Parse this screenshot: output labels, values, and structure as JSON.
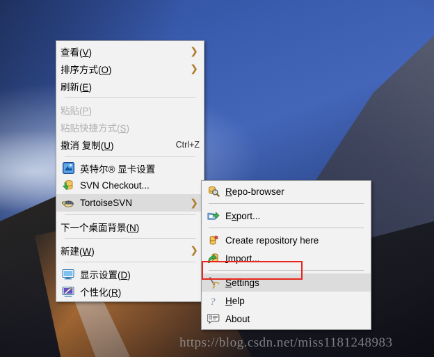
{
  "desktop": {
    "wallpaper_alt": "mountain-landscape-wallpaper",
    "watermark": "https://blog.csdn.net/miss1181248983"
  },
  "colors": {
    "menu_background": "#f2f2f2",
    "menu_border": "#a0a0a0",
    "highlight": "#dcdcdc",
    "separator": "#d2d2d2",
    "disabled_text": "#b0b0b0",
    "submenu_arrow": "#b07a2a",
    "annotation_red": "#e8261b",
    "text": "#000000"
  },
  "context_menu": {
    "name": "desktop-context-menu",
    "groups": [
      {
        "items": [
          {
            "label": "查看(V)",
            "icon": null,
            "submenu": true,
            "disabled": false,
            "accel": ""
          },
          {
            "label": "排序方式(O)",
            "icon": null,
            "submenu": true,
            "disabled": false,
            "accel": ""
          },
          {
            "label": "刷新(E)",
            "icon": null,
            "submenu": false,
            "disabled": false,
            "accel": ""
          }
        ]
      },
      {
        "items": [
          {
            "label": "粘贴(P)",
            "icon": null,
            "submenu": false,
            "disabled": true,
            "accel": ""
          },
          {
            "label": "粘贴快捷方式(S)",
            "icon": null,
            "submenu": false,
            "disabled": true,
            "accel": ""
          },
          {
            "label": "撤消 复制(U)",
            "icon": null,
            "submenu": false,
            "disabled": false,
            "accel": "Ctrl+Z"
          }
        ]
      },
      {
        "items": [
          {
            "label": "英特尔® 显卡设置",
            "icon": "intel-graphics-icon",
            "submenu": false,
            "disabled": false,
            "accel": ""
          },
          {
            "label": "SVN Checkout...",
            "icon": "svn-checkout-icon",
            "submenu": false,
            "disabled": false,
            "accel": ""
          },
          {
            "label": "TortoiseSVN",
            "icon": "tortoise-icon",
            "submenu": true,
            "disabled": false,
            "accel": "",
            "highlighted": true
          }
        ]
      },
      {
        "items": [
          {
            "label": "下一个桌面背景(N)",
            "icon": null,
            "submenu": false,
            "disabled": false,
            "accel": ""
          }
        ]
      },
      {
        "items": [
          {
            "label": "新建(W)",
            "icon": null,
            "submenu": true,
            "disabled": false,
            "accel": ""
          }
        ]
      },
      {
        "items": [
          {
            "label": "显示设置(D)",
            "icon": "display-settings-icon",
            "submenu": false,
            "disabled": false,
            "accel": ""
          },
          {
            "label": "个性化(R)",
            "icon": "personalize-icon",
            "submenu": false,
            "disabled": false,
            "accel": ""
          }
        ]
      }
    ]
  },
  "submenu": {
    "name": "tortoisesvn-submenu",
    "parent": "TortoiseSVN",
    "groups": [
      {
        "items": [
          {
            "label": "Repo-browser",
            "icon": "repo-browser-icon",
            "highlighted": false
          }
        ]
      },
      {
        "items": [
          {
            "label": "Export...",
            "icon": "export-icon",
            "highlighted": false
          }
        ]
      },
      {
        "items": [
          {
            "label": "Create repository here",
            "icon": "create-repository-icon",
            "highlighted": false
          },
          {
            "label": "Import...",
            "icon": "import-icon",
            "highlighted": false
          }
        ]
      },
      {
        "items": [
          {
            "label": "Settings",
            "icon": "settings-icon",
            "highlighted": true
          },
          {
            "label": "Help",
            "icon": "help-icon",
            "highlighted": false
          },
          {
            "label": "About",
            "icon": "about-icon",
            "highlighted": false
          }
        ]
      }
    ]
  },
  "annotation": {
    "name": "settings-highlight-box",
    "target": "Settings",
    "color": "#e8261b"
  }
}
